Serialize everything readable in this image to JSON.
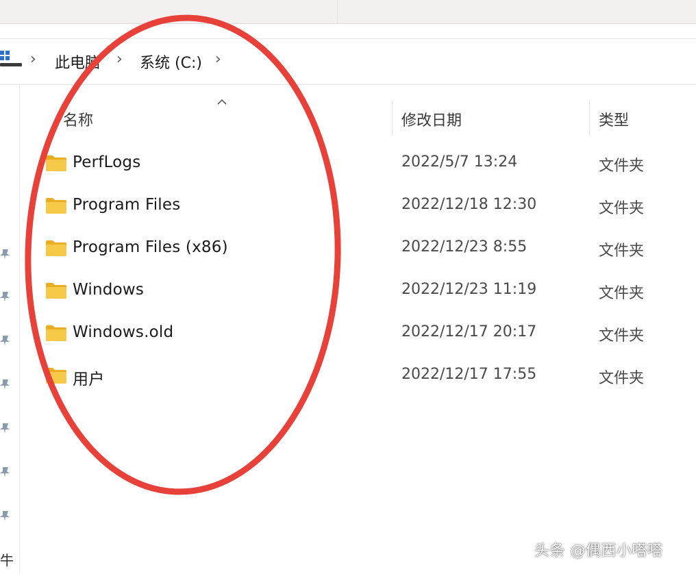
{
  "breadcrumb": {
    "items": [
      "此电脑",
      "系统 (C:)"
    ],
    "separator": "›"
  },
  "columns": {
    "name": "名称",
    "date_modified": "修改日期",
    "type": "类型"
  },
  "files": [
    {
      "name": "PerfLogs",
      "date": "2022/5/7 13:24",
      "type": "文件夹"
    },
    {
      "name": "Program Files",
      "date": "2022/12/18 12:30",
      "type": "文件夹"
    },
    {
      "name": "Program Files (x86)",
      "date": "2022/12/23 8:55",
      "type": "文件夹"
    },
    {
      "name": "Windows",
      "date": "2022/12/23 11:19",
      "type": "文件夹"
    },
    {
      "name": "Windows.old",
      "date": "2022/12/17 20:17",
      "type": "文件夹"
    },
    {
      "name": "用户",
      "date": "2022/12/17 17:55",
      "type": "文件夹"
    }
  ],
  "nav_partial_label": "牛",
  "watermark": "头条 @偶西小嗒嗒",
  "colors": {
    "highlight": "#e8413a",
    "folder": "#f7c948",
    "folder_dark": "#e9ae22",
    "pin": "#8a9bb0"
  },
  "icons": {
    "pc": "this-pc-icon",
    "folder": "folder-icon",
    "pin": "pin-icon",
    "sort": "sort-up-icon"
  }
}
